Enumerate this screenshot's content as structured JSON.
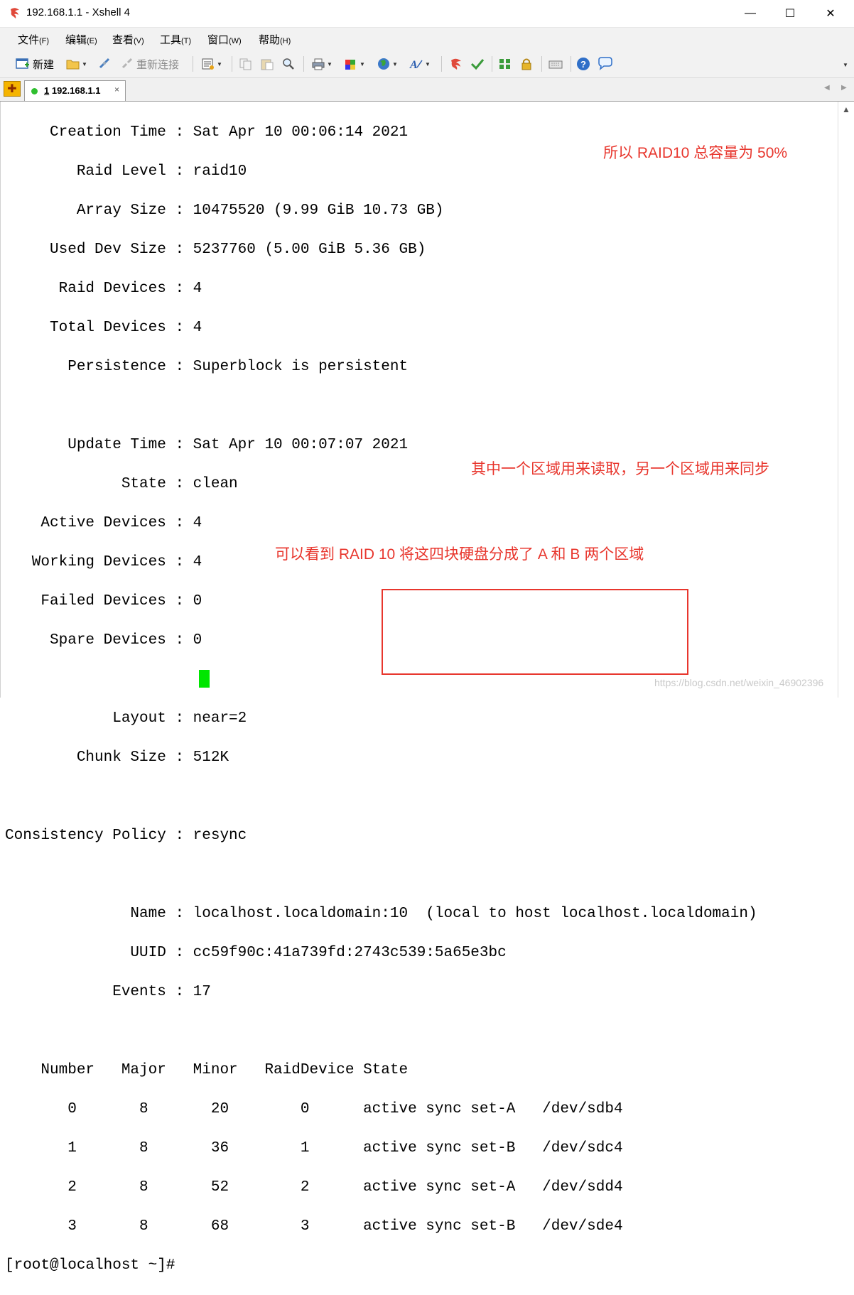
{
  "window": {
    "title": "192.168.1.1 - Xshell 4",
    "minimize": "—",
    "maximize": "☐",
    "close": "✕"
  },
  "menu": [
    {
      "label": "文件",
      "acc": "(F)"
    },
    {
      "label": "编辑",
      "acc": "(E)"
    },
    {
      "label": "查看",
      "acc": "(V)"
    },
    {
      "label": "工具",
      "acc": "(T)"
    },
    {
      "label": "窗口",
      "acc": "(W)"
    },
    {
      "label": "帮助",
      "acc": "(H)"
    }
  ],
  "toolbar": {
    "new_label": "新建",
    "reconnect_label": "重新连接"
  },
  "tabs": [
    {
      "index": "1",
      "label": " 192.168.1.1",
      "close": "×"
    }
  ],
  "terminal": {
    "lines": [
      "     Creation Time : Sat Apr 10 00:06:14 2021",
      "        Raid Level : raid10",
      "        Array Size : 10475520 (9.99 GiB 10.73 GB)",
      "     Used Dev Size : 5237760 (5.00 GiB 5.36 GB)",
      "      Raid Devices : 4",
      "     Total Devices : 4",
      "       Persistence : Superblock is persistent",
      "",
      "       Update Time : Sat Apr 10 00:07:07 2021",
      "             State : clean",
      "    Active Devices : 4",
      "   Working Devices : 4",
      "    Failed Devices : 0",
      "     Spare Devices : 0",
      "",
      "            Layout : near=2",
      "        Chunk Size : 512K",
      "",
      "Consistency Policy : resync",
      "",
      "              Name : localhost.localdomain:10  (local to host localhost.localdomain)",
      "              UUID : cc59f90c:41a739fd:2743c539:5a65e3bc",
      "            Events : 17",
      "",
      "    Number   Major   Minor   RaidDevice State",
      "       0       8       20        0      active sync set-A   /dev/sdb4",
      "       1       8       36        1      active sync set-B   /dev/sdc4",
      "       2       8       52        2      active sync set-A   /dev/sdd4",
      "       3       8       68        3      active sync set-B   /dev/sde4"
    ],
    "prompt": "[root@localhost ~]# "
  },
  "annotations": {
    "capacity_note": "所以 RAID10 总容量为 50%",
    "sync_note": "其中一个区域用来读取，另一个区域用来同步",
    "split_note": "可以看到 RAID 10 将这四块硬盘分成了 A 和 B 两个区域"
  },
  "watermark": "https://blog.csdn.net/weixin_46902396",
  "colors": {
    "annotation": "#e8362d",
    "cursor": "#00e600",
    "tab_status": "#2fbf2f"
  }
}
